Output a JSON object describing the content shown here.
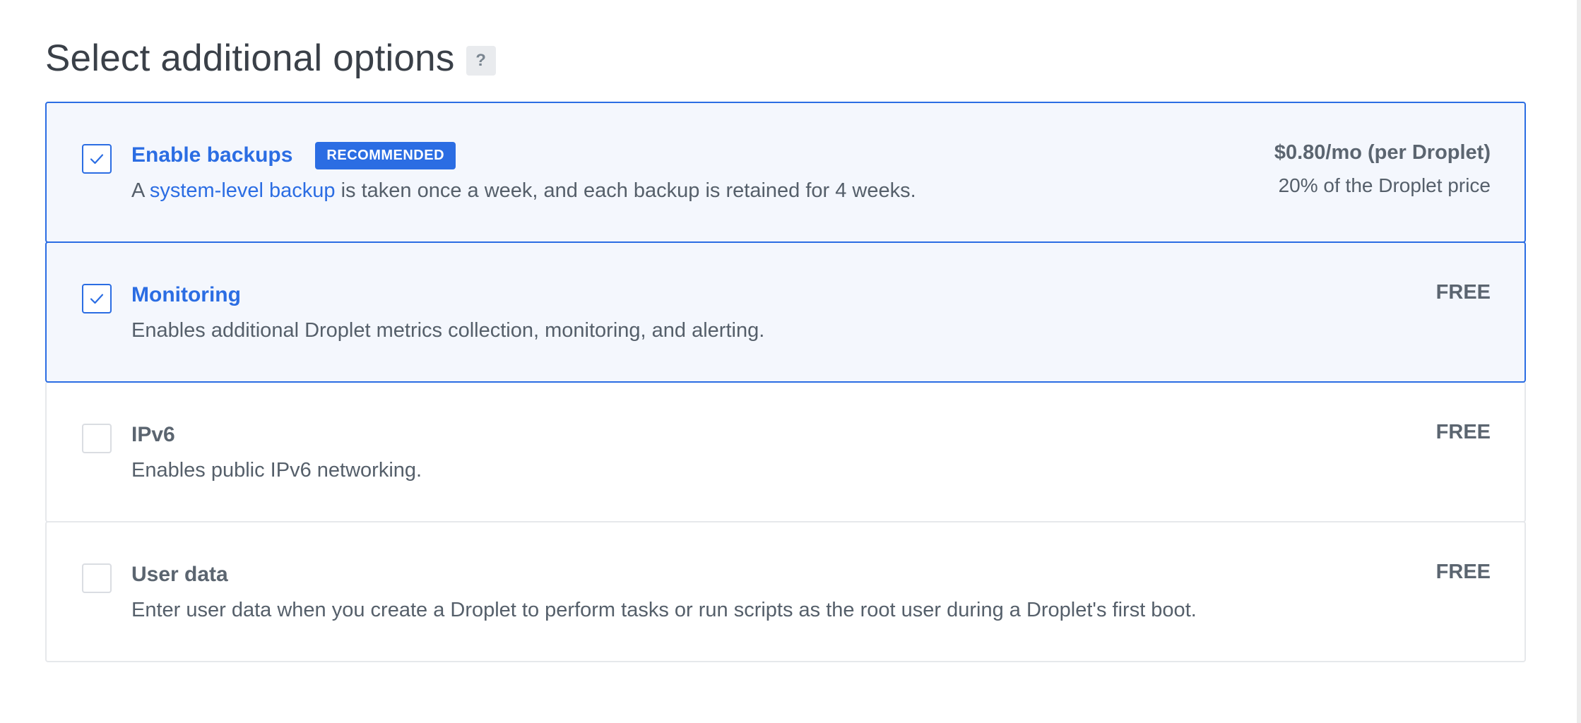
{
  "header": {
    "title": "Select additional options",
    "help_label": "?"
  },
  "options": [
    {
      "name": "Enable backups",
      "badge": "RECOMMENDED",
      "checked": true,
      "desc_prefix": "A ",
      "desc_link": "system-level backup",
      "desc_suffix": " is taken once a week, and each backup is retained for 4 weeks.",
      "price": "$0.80/mo (per Droplet)",
      "price_note": "20% of the Droplet price"
    },
    {
      "name": "Monitoring",
      "checked": true,
      "description": "Enables additional Droplet metrics collection, monitoring, and alerting.",
      "price": "FREE"
    },
    {
      "name": "IPv6",
      "checked": false,
      "description": "Enables public IPv6 networking.",
      "price": "FREE"
    },
    {
      "name": "User data",
      "checked": false,
      "description": "Enter user data when you create a Droplet to perform tasks or run scripts as the root user during a Droplet's first boot.",
      "price": "FREE"
    }
  ],
  "colors": {
    "accent": "#2b6de3",
    "selected_bg": "#f4f7fd",
    "border": "#e6e8eb"
  },
  "icons": {
    "check": "checkmark-icon",
    "help": "question-icon"
  }
}
